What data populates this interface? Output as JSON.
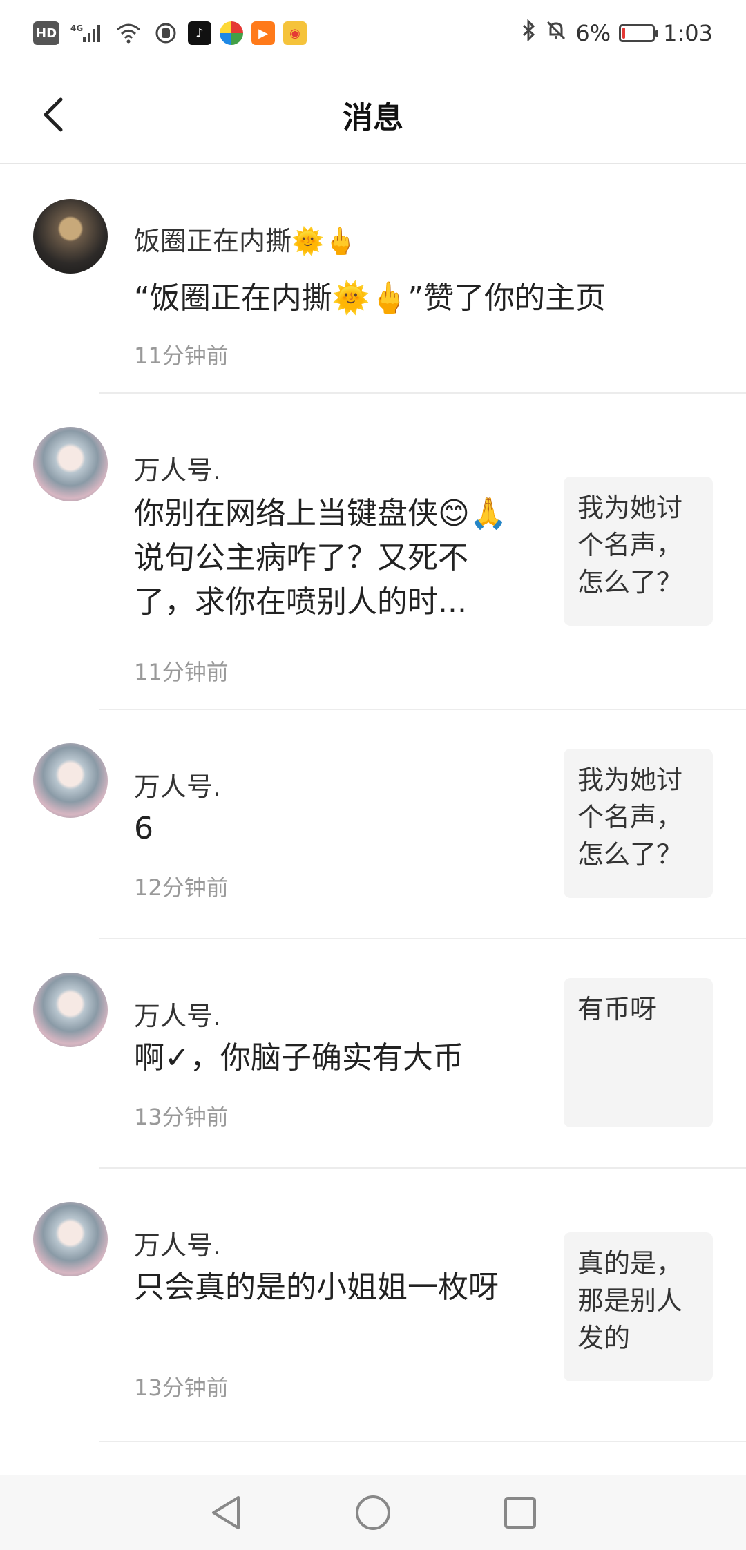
{
  "status_bar": {
    "hd": "HD",
    "network": "4G",
    "battery_percent": "6%",
    "battery_level": 0.06,
    "time": "1:03",
    "icons": [
      "hd-icon",
      "signal-icon",
      "wifi-icon",
      "hand-icon",
      "douyin-icon",
      "colorful-app-icon",
      "play-app-icon",
      "weibo-icon",
      "bluetooth-icon",
      "mute-icon",
      "battery-icon"
    ]
  },
  "header": {
    "title": "消息",
    "back_icon": "chevron-left-icon"
  },
  "messages": [
    {
      "name": "饭圈正在内撕🌞🖕",
      "content": "“饭圈正在内撕🌞🖕”赞了你的主页",
      "time": "11分钟前",
      "quote": ""
    },
    {
      "name": "万人号.",
      "content": "你别在网络上当键盘侠😊🙏说句公主病咋了？又死不了，求你在喷别人的时...",
      "time": "11分钟前",
      "quote": "我为她讨个名声，怎么了？"
    },
    {
      "name": "万人号.",
      "content": "6",
      "time": "12分钟前",
      "quote": "我为她讨个名声，怎么了？"
    },
    {
      "name": "万人号.",
      "content": "啊✓，你脑子确实有大币",
      "time": "13分钟前",
      "quote": "有币呀"
    },
    {
      "name": "万人号.",
      "content": "只会真的是的小姐姐一枚呀",
      "time": "13分钟前",
      "quote": "真的是，那是别人发的"
    }
  ],
  "nav": {
    "back_icon": "triangle-back-icon",
    "home_icon": "circle-home-icon",
    "recent_icon": "square-recent-icon"
  }
}
